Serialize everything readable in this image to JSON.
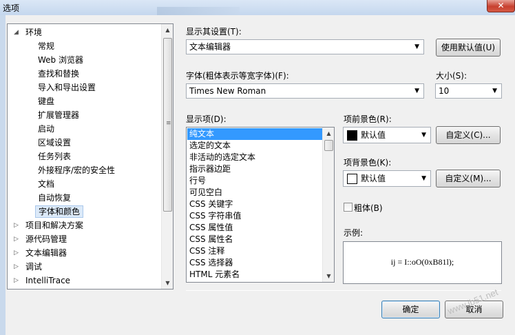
{
  "window": {
    "title": "选项",
    "close_symbol": "✕"
  },
  "tree": {
    "items": [
      {
        "label": "环境",
        "level": 0,
        "expander": "◢"
      },
      {
        "label": "常规",
        "level": 1
      },
      {
        "label": "Web 浏览器",
        "level": 1
      },
      {
        "label": "查找和替换",
        "level": 1
      },
      {
        "label": "导入和导出设置",
        "level": 1
      },
      {
        "label": "键盘",
        "level": 1
      },
      {
        "label": "扩展管理器",
        "level": 1
      },
      {
        "label": "启动",
        "level": 1
      },
      {
        "label": "区域设置",
        "level": 1
      },
      {
        "label": "任务列表",
        "level": 1
      },
      {
        "label": "外接程序/宏的安全性",
        "level": 1
      },
      {
        "label": "文档",
        "level": 1
      },
      {
        "label": "自动恢复",
        "level": 1
      },
      {
        "label": "字体和颜色",
        "level": 1,
        "selected": true
      },
      {
        "label": "项目和解决方案",
        "level": 0,
        "expander": "▷"
      },
      {
        "label": "源代码管理",
        "level": 0,
        "expander": "▷"
      },
      {
        "label": "文本编辑器",
        "level": 0,
        "expander": "▷"
      },
      {
        "label": "调试",
        "level": 0,
        "expander": "▷"
      },
      {
        "label": "IntelliTrace",
        "level": 0,
        "expander": "▷"
      }
    ]
  },
  "show_settings_for": {
    "label": "显示其设置(T):",
    "value": "文本编辑器"
  },
  "use_defaults_button": "使用默认值(U)",
  "font": {
    "label": "字体(粗体表示等宽字体)(F):",
    "value": "Times New Roman"
  },
  "size": {
    "label": "大小(S):",
    "value": "10"
  },
  "display_items": {
    "label": "显示项(D):",
    "items": [
      "纯文本",
      "选定的文本",
      "非活动的选定文本",
      "指示器边距",
      "行号",
      "可见空白",
      "CSS 关键字",
      "CSS 字符串值",
      "CSS 属性值",
      "CSS 属性名",
      "CSS 注释",
      "CSS 选择器",
      "HTML 元素名"
    ],
    "selected_index": 0
  },
  "foreground": {
    "label": "项前景色(R):",
    "value": "默认值",
    "swatch_color": "#000000",
    "custom_button": "自定义(C)..."
  },
  "background": {
    "label": "项背景色(K):",
    "value": "默认值",
    "swatch_color": "#ffffff",
    "custom_button": "自定义(M)..."
  },
  "bold": {
    "label": "粗体(B)",
    "checked": false
  },
  "sample": {
    "label": "示例:",
    "text": "ij = I::oO(0xB81l);"
  },
  "footer": {
    "ok_button": "确定",
    "cancel_button": "取消"
  },
  "watermark": "www.jb51.net"
}
